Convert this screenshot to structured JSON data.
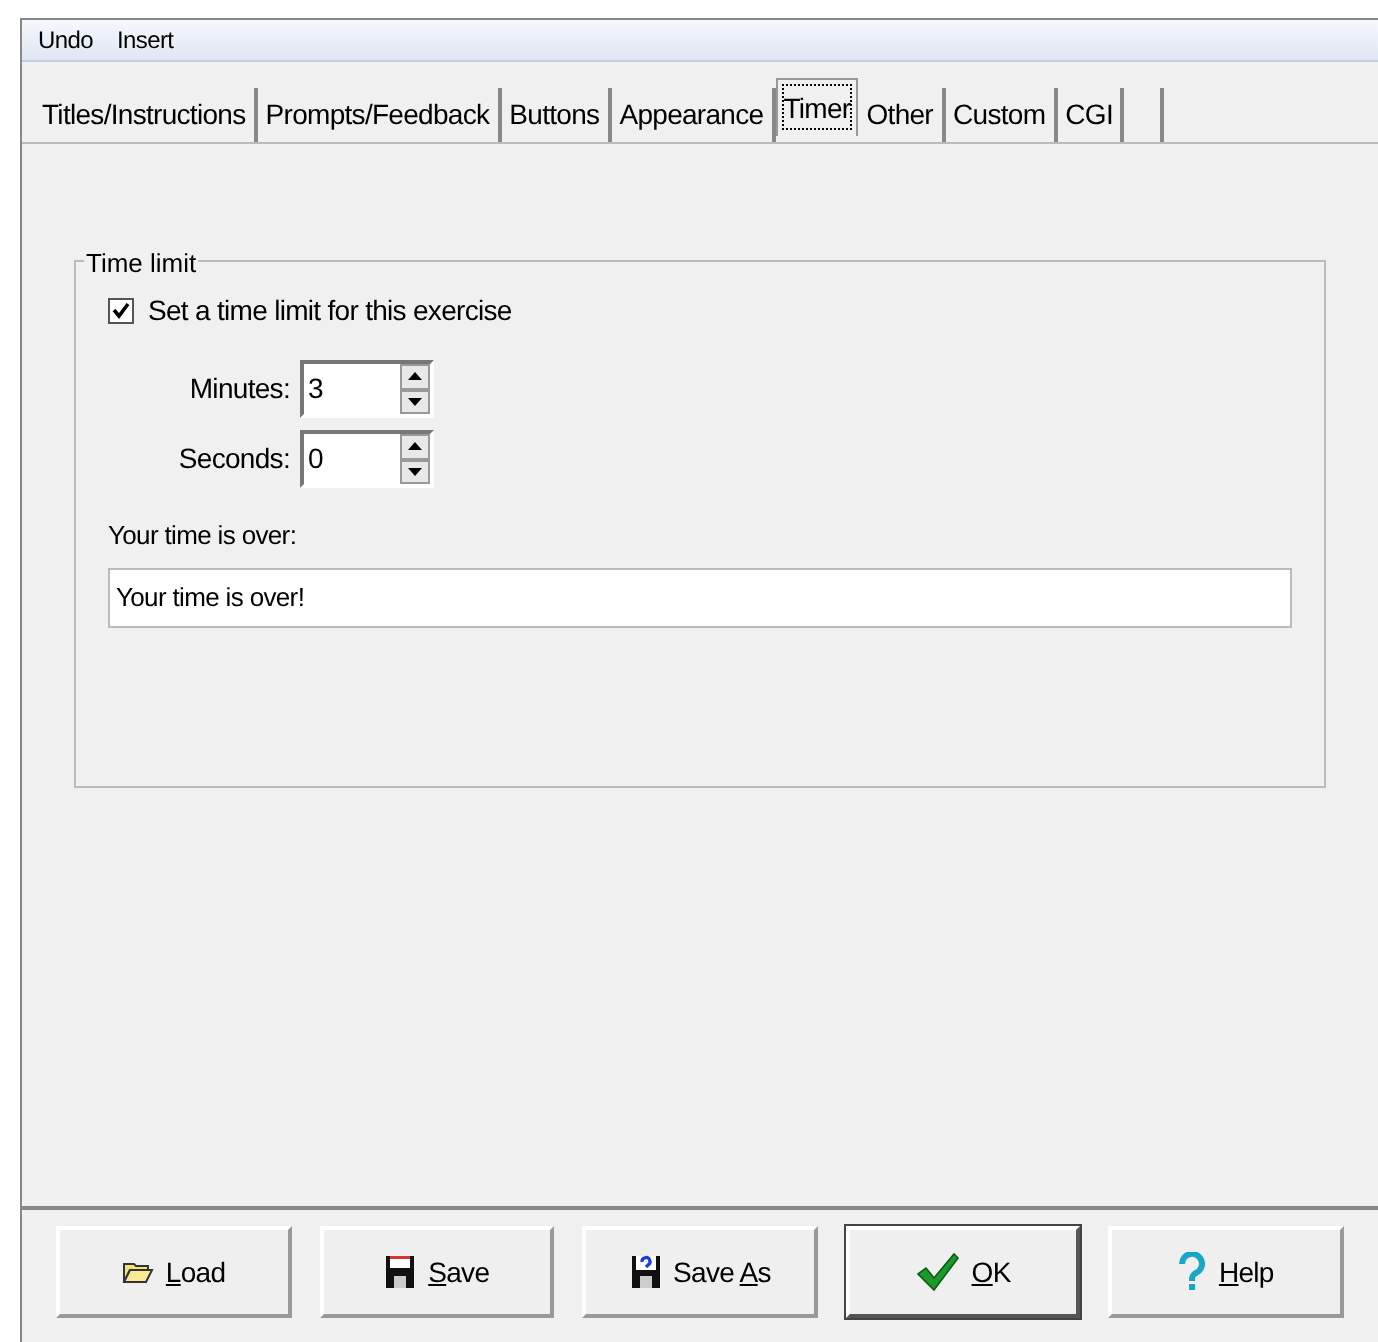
{
  "menu": [
    "Undo",
    "Insert"
  ],
  "tabs": [
    {
      "label": "Titles/Instructions",
      "selected": false
    },
    {
      "label": "Prompts/Feedback",
      "selected": false
    },
    {
      "label": "Buttons",
      "selected": false
    },
    {
      "label": "Appearance",
      "selected": false
    },
    {
      "label": "Timer",
      "selected": true
    },
    {
      "label": "Other",
      "selected": false
    },
    {
      "label": "Custom",
      "selected": false
    },
    {
      "label": "CGI",
      "selected": false
    }
  ],
  "group": {
    "title": "Time limit",
    "checkbox": {
      "label": "Set a time limit for this exercise",
      "checked": true
    },
    "spinners": [
      {
        "label": "Minutes:",
        "value": "3"
      },
      {
        "label": "Seconds:",
        "value": "0"
      }
    ],
    "message_label": "Your time is over:",
    "message_value": "Your time is over!"
  },
  "buttons": [
    {
      "kind": "load",
      "key": "L",
      "after": "oad",
      "default": false
    },
    {
      "kind": "save",
      "key": "S",
      "after": "ave",
      "default": false
    },
    {
      "kind": "saveas",
      "before": "Save ",
      "key": "A",
      "after": "s",
      "default": false
    },
    {
      "kind": "ok",
      "key": "O",
      "after": "K",
      "default": true
    },
    {
      "kind": "help",
      "key": "H",
      "after": "elp",
      "default": false
    }
  ]
}
